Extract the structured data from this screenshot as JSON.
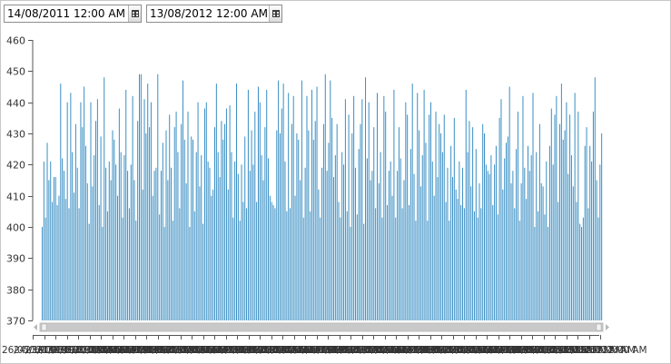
{
  "date_range": {
    "start": "14/08/2011 12:00 AM",
    "end": "13/08/2012 12:00 AM",
    "calendar_icon": "calendar-icon"
  },
  "chart_data": {
    "type": "bar",
    "title": "",
    "xlabel": "",
    "ylabel": "",
    "ylim": [
      370,
      460
    ],
    "yticks": [
      370,
      380,
      390,
      400,
      410,
      420,
      430,
      440,
      450,
      460
    ],
    "grid": false,
    "bar_color": "#3a8fc4",
    "x_tick_labels_note_overlapping": true,
    "x_tick_labels": [
      "26/05/1900 12:00 AM",
      "24/06/1901 12:00 AM",
      "23/07/1902 12:00 AM",
      "21/08/1903 12:00 AM",
      "19/09/1904 12:00 AM",
      "18/10/1905 12:00 AM",
      "16/11/1906 12:00 AM",
      "15/12/1907 12:00 AM"
    ],
    "values": [
      400,
      421,
      403,
      427,
      415,
      421,
      408,
      416,
      416,
      407,
      410,
      446,
      422,
      418,
      409,
      440,
      406,
      443,
      424,
      411,
      433,
      419,
      406,
      440,
      432,
      445,
      426,
      414,
      401,
      440,
      413,
      423,
      434,
      441,
      407,
      429,
      400,
      448,
      419,
      405,
      421,
      415,
      431,
      428,
      420,
      410,
      438,
      424,
      403,
      423,
      444,
      418,
      406,
      420,
      442,
      415,
      402,
      434,
      449,
      449,
      412,
      441,
      430,
      446,
      432,
      440,
      410,
      418,
      419,
      449,
      404,
      418,
      427,
      400,
      431,
      415,
      436,
      419,
      402,
      432,
      437,
      424,
      406,
      433,
      447,
      428,
      414,
      437,
      400,
      429,
      428,
      405,
      424,
      440,
      413,
      423,
      401,
      438,
      440,
      421,
      419,
      410,
      412,
      432,
      446,
      424,
      416,
      434,
      428,
      433,
      438,
      412,
      439,
      424,
      403,
      421,
      446,
      417,
      402,
      420,
      408,
      429,
      406,
      444,
      418,
      431,
      420,
      437,
      408,
      445,
      440,
      423,
      415,
      432,
      444,
      422,
      410,
      408,
      407,
      406,
      431,
      447,
      430,
      438,
      446,
      421,
      405,
      443,
      406,
      433,
      442,
      410,
      430,
      428,
      415,
      447,
      403,
      419,
      442,
      431,
      405,
      444,
      428,
      434,
      445,
      412,
      403,
      419,
      433,
      449,
      418,
      427,
      447,
      435,
      416,
      423,
      433,
      408,
      403,
      424,
      420,
      441,
      405,
      436,
      400,
      430,
      442,
      419,
      404,
      425,
      433,
      441,
      401,
      448,
      422,
      440,
      415,
      418,
      432,
      406,
      443,
      414,
      424,
      403,
      442,
      437,
      407,
      418,
      421,
      410,
      444,
      403,
      418,
      432,
      422,
      406,
      415,
      440,
      436,
      407,
      425,
      446,
      417,
      402,
      443,
      431,
      413,
      423,
      444,
      427,
      402,
      436,
      440,
      421,
      410,
      437,
      416,
      433,
      430,
      424,
      436,
      408,
      419,
      402,
      426,
      416,
      435,
      412,
      409,
      421,
      407,
      419,
      406,
      444,
      424,
      434,
      413,
      432,
      405,
      425,
      403,
      414,
      406,
      433,
      430,
      420,
      418,
      417,
      423,
      407,
      420,
      426,
      404,
      435,
      441,
      412,
      422,
      427,
      429,
      445,
      414,
      418,
      406,
      425,
      437,
      402,
      414,
      442,
      419,
      409,
      426,
      418,
      423,
      443,
      400,
      424,
      405,
      433,
      414,
      413,
      404,
      421,
      400,
      426,
      438,
      420,
      436,
      442,
      408,
      433,
      446,
      428,
      431,
      440,
      417,
      436,
      423,
      413,
      443,
      408,
      437,
      401,
      400,
      403,
      426,
      432,
      406,
      426,
      421,
      437,
      448,
      415,
      403,
      420,
      430
    ]
  }
}
